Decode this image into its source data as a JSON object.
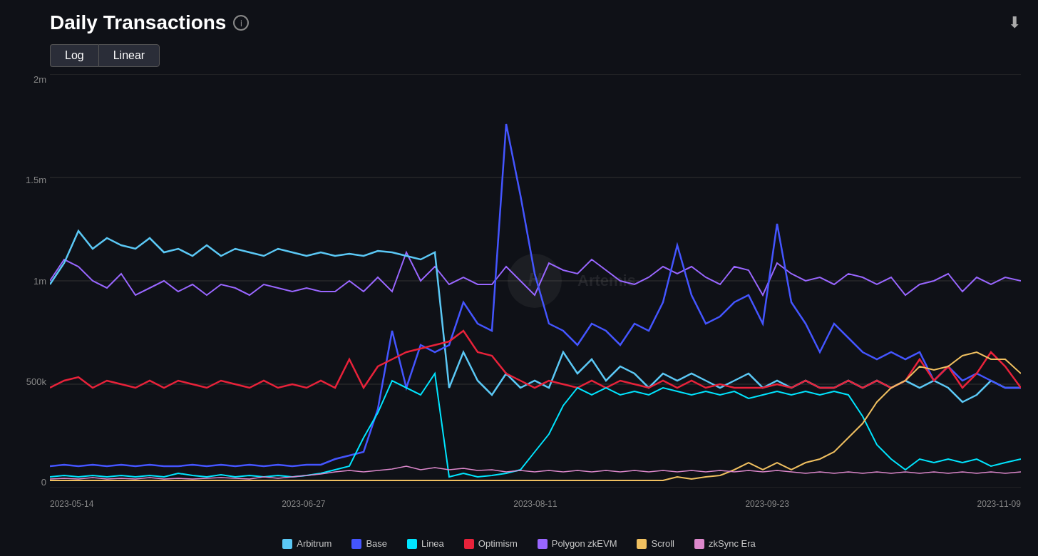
{
  "header": {
    "title": "Daily Transactions",
    "info_icon": "ⓘ",
    "download_icon": "⬇"
  },
  "scale_buttons": {
    "log_label": "Log",
    "linear_label": "Linear"
  },
  "y_axis": {
    "labels": [
      "2m",
      "1.5m",
      "1m",
      "500k",
      "0"
    ]
  },
  "x_axis": {
    "labels": [
      "2023-05-14",
      "2023-06-27",
      "2023-08-11",
      "2023-09-23",
      "2023-11-09"
    ]
  },
  "legend": {
    "items": [
      {
        "label": "Arbitrum",
        "color": "#5bc8f5"
      },
      {
        "label": "Base",
        "color": "#4455ff"
      },
      {
        "label": "Linea",
        "color": "#00e5ff"
      },
      {
        "label": "Optimism",
        "color": "#e8223a"
      },
      {
        "label": "Polygon zkEVM",
        "color": "#9966ff"
      },
      {
        "label": "Scroll",
        "color": "#f0c060"
      },
      {
        "label": "zkSync Era",
        "color": "#cc88cc"
      }
    ]
  },
  "watermark": {
    "text": "Artemis"
  }
}
